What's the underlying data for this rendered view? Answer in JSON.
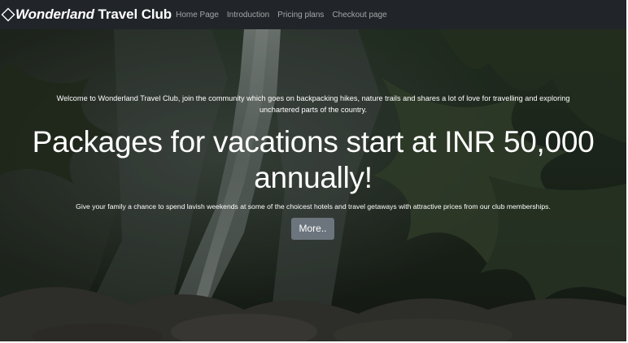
{
  "navbar": {
    "brand_part1": "Wonderland",
    "brand_part2": " Travel Club",
    "brand_icon": "diamond-icon",
    "links": [
      {
        "label": "Home Page"
      },
      {
        "label": "Introduction"
      },
      {
        "label": "Pricing plans"
      },
      {
        "label": "Checkout page"
      }
    ]
  },
  "hero": {
    "welcome": "Welcome to Wonderland Travel Club, join the community which goes on backpacking hikes, nature trails and shares a lot of love for travelling and exploring unchartered parts of the country.",
    "headline": "Packages for vacations start at INR 50,000 annually!",
    "subtext": "Give your family a chance to spend lavish weekends at some of the choicest hotels and travel getaways with attractive prices from our club memberships.",
    "button_label": "More..",
    "background": "waterfall-forest-image"
  },
  "colors": {
    "navbar_bg": "#212529",
    "button_bg": "#6c757d",
    "text": "#ffffff"
  }
}
